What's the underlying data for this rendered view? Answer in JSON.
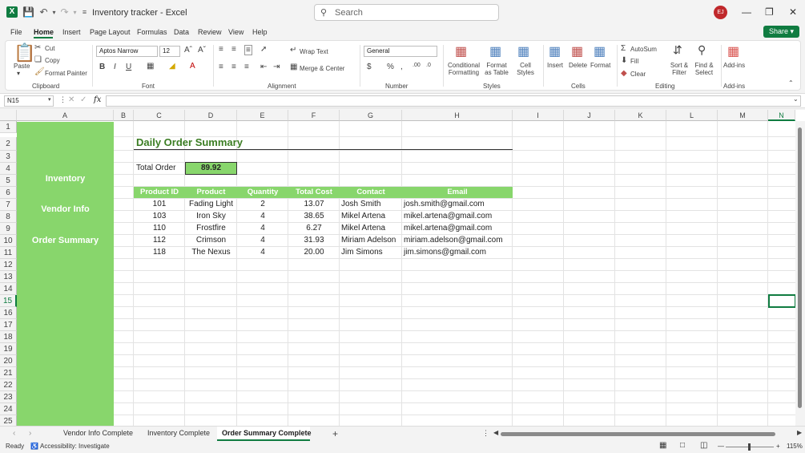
{
  "window": {
    "doc_title": "Inventory tracker  -  Excel",
    "search_placeholder": "Search",
    "user_initials": "EJ",
    "share_label": "Share"
  },
  "menu": [
    "File",
    "Home",
    "Insert",
    "Page Layout",
    "Formulas",
    "Data",
    "Review",
    "View",
    "Help"
  ],
  "ribbon": {
    "clipboard": {
      "paste": "Paste",
      "cut": "Cut",
      "copy": "Copy",
      "format_painter": "Format Painter",
      "label": "Clipboard"
    },
    "font": {
      "name": "Aptos Narrow",
      "size": "12",
      "label": "Font"
    },
    "alignment": {
      "wrap": "Wrap Text",
      "merge": "Merge & Center",
      "label": "Alignment"
    },
    "number": {
      "format": "General",
      "label": "Number"
    },
    "styles": {
      "conditional": "Conditional Formatting",
      "format_table": "Format as Table",
      "cell_styles": "Cell Styles",
      "label": "Styles"
    },
    "cells": {
      "insert": "Insert",
      "delete": "Delete",
      "format": "Format",
      "label": "Cells"
    },
    "editing": {
      "autosum": "AutoSum",
      "fill": "Fill",
      "clear": "Clear",
      "sort": "Sort & Filter",
      "find": "Find & Select",
      "label": "Editing"
    },
    "addins": {
      "addins": "Add-ins",
      "label": "Add-ins"
    }
  },
  "formula_bar": {
    "name_box": "N15",
    "fx": "fx",
    "content": ""
  },
  "columns": [
    "A",
    "B",
    "C",
    "D",
    "E",
    "F",
    "G",
    "H",
    "I",
    "J",
    "K",
    "L",
    "M",
    "N"
  ],
  "rows": [
    "1",
    "2",
    "3",
    "4",
    "5",
    "6",
    "7",
    "8",
    "9",
    "10",
    "11",
    "12",
    "13",
    "14",
    "15",
    "16",
    "17",
    "18",
    "19",
    "20",
    "21",
    "22",
    "23",
    "24",
    "25"
  ],
  "sidebar_links": [
    "Inventory",
    "Vendor Info",
    "Order Summary"
  ],
  "sheet": {
    "title": "Daily Order Summary",
    "total_label": "Total Order",
    "total_value": "89.92",
    "headers": [
      "Product ID",
      "Product",
      "Quantity",
      "Total Cost",
      "Contact",
      "Email"
    ],
    "rows": [
      [
        "101",
        "Fading Light",
        "2",
        "13.07",
        "Josh Smith",
        "josh.smith@gmail.com"
      ],
      [
        "103",
        "Iron Sky",
        "4",
        "38.65",
        "Mikel Artena",
        "mikel.artena@gmail.com"
      ],
      [
        "110",
        "Frostfire",
        "4",
        "6.27",
        "Mikel Artena",
        "mikel.artena@gmail.com"
      ],
      [
        "112",
        "Crimson",
        "4",
        "31.93",
        "Miriam Adelson",
        "miriam.adelson@gmail.com"
      ],
      [
        "118",
        "The Nexus",
        "4",
        "20.00",
        "Jim Simons",
        "jim.simons@gmail.com"
      ]
    ]
  },
  "sheet_tabs": [
    "Vendor Info Complete",
    "Inventory Complete",
    "Order Summary Complete"
  ],
  "status": {
    "ready": "Ready",
    "accessibility": "Accessibility: Investigate",
    "zoom": "115%"
  },
  "colors": {
    "accent": "#107c41",
    "nav_green": "#88d66c",
    "title_green": "#3b7d23"
  }
}
